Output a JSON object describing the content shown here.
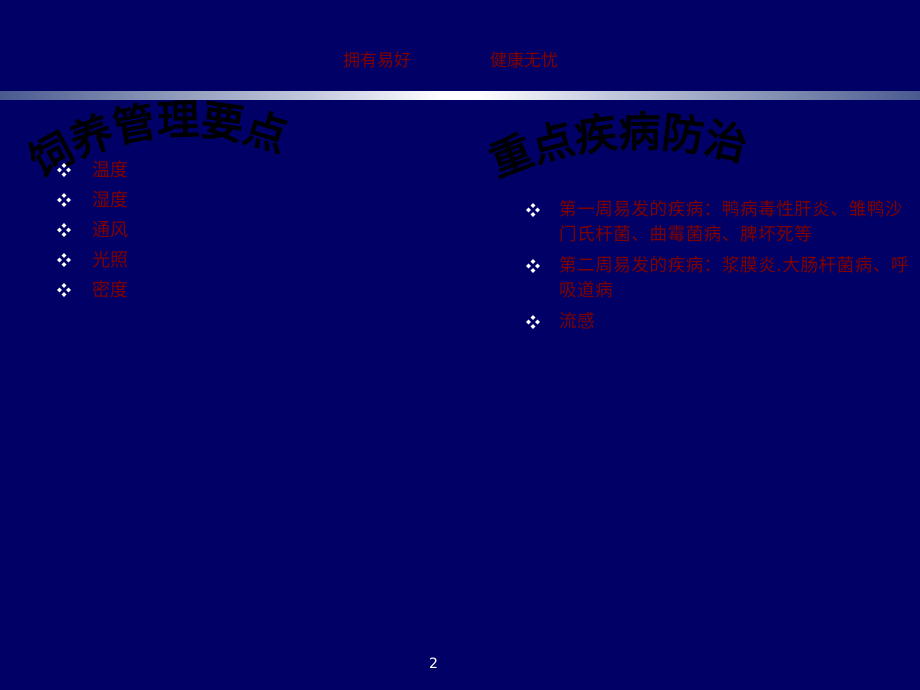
{
  "header": {
    "left": "拥有易好",
    "right": "健康无忧"
  },
  "left_section": {
    "title": "饲养管理要点",
    "items": [
      {
        "label": "温度"
      },
      {
        "label": "湿度"
      },
      {
        "label": "通风"
      },
      {
        "label": "光照"
      },
      {
        "label": "密度"
      }
    ]
  },
  "right_section": {
    "title": "重点疾病防治",
    "items": [
      {
        "label": "第一周易发的疾病：鸭病毒性肝炎、雏鸭沙门氏杆菌、曲霉菌病、脾坏死等"
      },
      {
        "label": "第二周易发的疾病：浆膜炎.大肠杆菌病、呼吸道病"
      },
      {
        "label": "流感"
      }
    ]
  },
  "bullet_icon": "four-diamond-bullet-icon",
  "colors": {
    "background": "#000066",
    "body_text": "#800000",
    "title_text": "#000000",
    "bullet": "#ffffff"
  },
  "page_number": "2"
}
